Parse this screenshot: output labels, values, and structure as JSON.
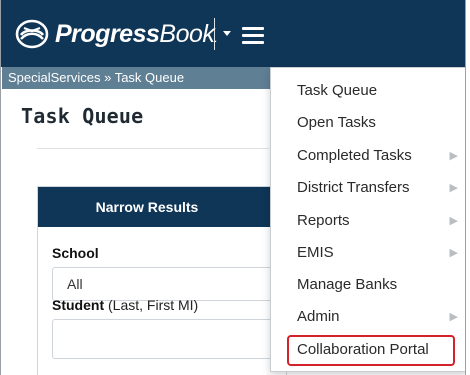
{
  "app": {
    "logo_bold": "Progress",
    "logo_light": "Book"
  },
  "breadcrumb": {
    "text": "SpecialServices » Task Queue"
  },
  "page": {
    "title": "Task Queue"
  },
  "panel": {
    "heading": "Narrow Results",
    "school_label": "School",
    "school_value": "All",
    "student_label": "Student",
    "student_hint": "(Last, First MI)",
    "student_value": ""
  },
  "menu": {
    "items": [
      {
        "label": "Task Queue",
        "submenu": false
      },
      {
        "label": "Open Tasks",
        "submenu": false
      },
      {
        "label": "Completed Tasks",
        "submenu": true
      },
      {
        "label": "District Transfers",
        "submenu": true
      },
      {
        "label": "Reports",
        "submenu": true
      },
      {
        "label": "EMIS",
        "submenu": true
      },
      {
        "label": "Manage Banks",
        "submenu": false
      },
      {
        "label": "Admin",
        "submenu": true
      },
      {
        "label": "Collaboration Portal",
        "submenu": false,
        "highlighted": true
      }
    ],
    "chevron": "▶"
  },
  "colors": {
    "navbar": "#0f3557",
    "breadcrumb": "#5f7f95",
    "highlight_outline": "#d3222a"
  },
  "icons": {
    "logo": "progressbook-logo-icon",
    "menu": "hamburger-menu-icon",
    "caret": "caret-down-icon",
    "submenu": "chevron-right-icon"
  }
}
